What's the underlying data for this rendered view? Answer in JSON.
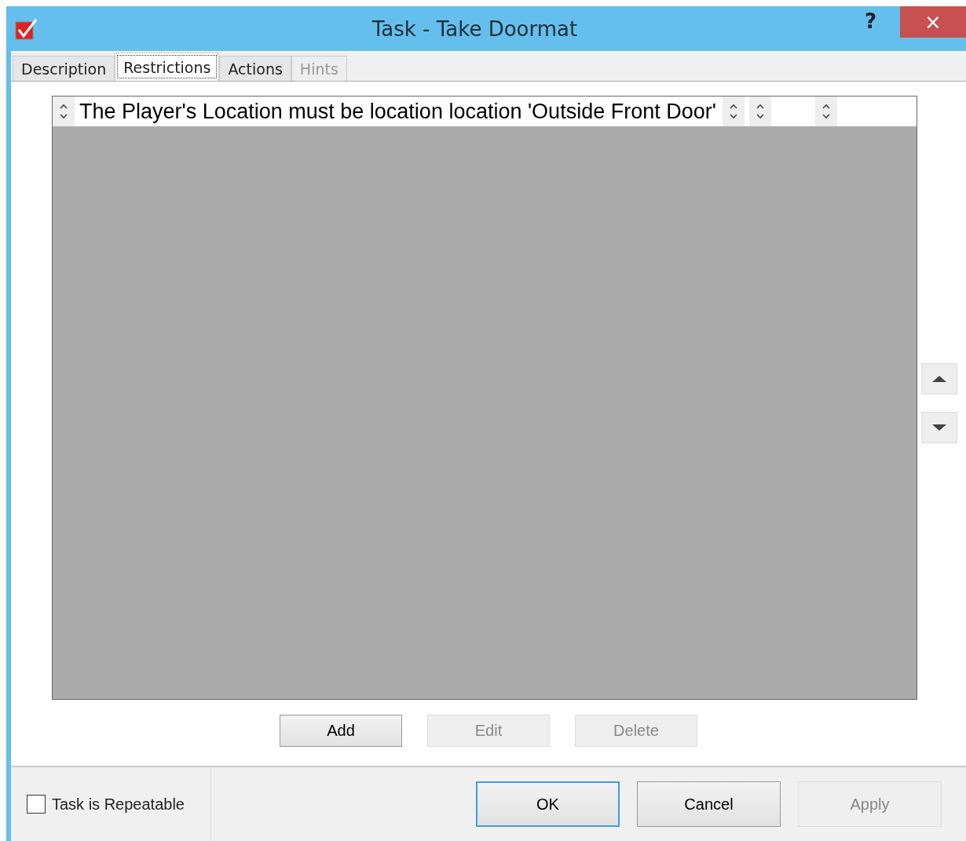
{
  "window": {
    "title": "Task - Take Doormat",
    "help": "?",
    "close": "×"
  },
  "tabs": [
    {
      "label": "Description",
      "selected": false,
      "disabled": false
    },
    {
      "label": "Restrictions",
      "selected": true,
      "disabled": false
    },
    {
      "label": "Actions",
      "selected": false,
      "disabled": false
    },
    {
      "label": "Hints",
      "selected": false,
      "disabled": true
    }
  ],
  "restrictions": [
    {
      "text": "The Player's Location must be location location 'Outside Front Door'"
    }
  ],
  "list_buttons": [
    {
      "label": "Add",
      "disabled": false
    },
    {
      "label": "Edit",
      "disabled": true
    },
    {
      "label": "Delete",
      "disabled": true
    }
  ],
  "repeatable": {
    "label": "Task is Repeatable",
    "checked": false
  },
  "dialog_buttons": [
    {
      "label": "OK",
      "disabled": false,
      "default": true
    },
    {
      "label": "Cancel",
      "disabled": false,
      "default": false
    },
    {
      "label": "Apply",
      "disabled": true,
      "default": false
    }
  ]
}
